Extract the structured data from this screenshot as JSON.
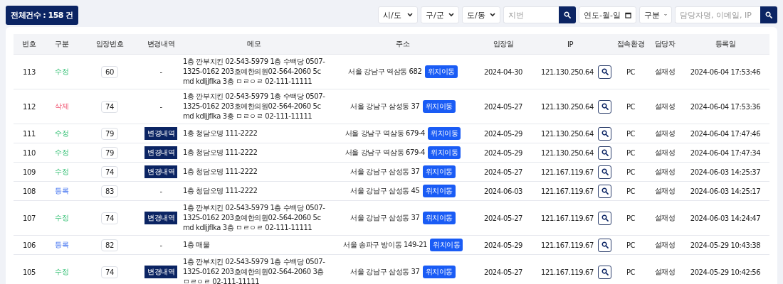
{
  "total_badge": "전체건수 : 158 건",
  "filters": {
    "selects": [
      "시/도",
      "구/군",
      "도/동"
    ],
    "lot_placeholder": "지번",
    "date_placeholder": "연도-월-일",
    "type_select": "구분",
    "keyword_placeholder": "담당자명, 이메일, IP"
  },
  "table": {
    "columns": [
      "번호",
      "구분",
      "임장번호",
      "변경내역",
      "메모",
      "주소",
      "임장일",
      "IP",
      "접속환경",
      "담당자",
      "등록일"
    ],
    "rows": [
      {
        "no": "113",
        "category": {
          "text": "수정",
          "kind": "edit"
        },
        "visit_no": "60",
        "history": {
          "kind": "none",
          "text": "-"
        },
        "memo": "1층 깐부치킨 02-543-5979 1층 수백당 0507-1325-0162 203호예한의원02-564-2060 5cmd kdljjflka 3층 ㅁㄹㅇㄹ 02-111-11111",
        "address": "서울 강남구 역삼동 682",
        "move_label": "위치이동",
        "visit_date": "2024-04-30",
        "ip": "121.130.250.64",
        "env": "PC",
        "manager": "설재성",
        "registered": "2024-06-04 17:53:46"
      },
      {
        "no": "112",
        "category": {
          "text": "삭제",
          "kind": "delete"
        },
        "visit_no": "74",
        "history": {
          "kind": "none",
          "text": "-"
        },
        "memo": "1층 깐부치킨 02-543-5979 1층 수백당 0507-1325-0162 203호예한의원02-564-2060 5cmd kdljjflka 3층 ㅁㄹㅇㄹ 02-111-11111",
        "address": "서울 강남구 삼성동 37",
        "move_label": "위치이동",
        "visit_date": "2024-05-27",
        "ip": "121.130.250.64",
        "env": "PC",
        "manager": "설재성",
        "registered": "2024-06-04 17:53:36"
      },
      {
        "no": "111",
        "category": {
          "text": "수정",
          "kind": "edit"
        },
        "visit_no": "79",
        "history": {
          "kind": "button",
          "text": "변경내역"
        },
        "memo": "1층 청담오뎅 111-2222",
        "address": "서울 강남구 역삼동 679-4",
        "move_label": "위치이동",
        "visit_date": "2024-05-29",
        "ip": "121.130.250.64",
        "env": "PC",
        "manager": "설재성",
        "registered": "2024-06-04 17:47:46"
      },
      {
        "no": "110",
        "category": {
          "text": "수정",
          "kind": "edit"
        },
        "visit_no": "79",
        "history": {
          "kind": "button",
          "text": "변경내역"
        },
        "memo": "1층 청담오뎅 111-2222",
        "address": "서울 강남구 역삼동 679-4",
        "move_label": "위치이동",
        "visit_date": "2024-05-29",
        "ip": "121.130.250.64",
        "env": "PC",
        "manager": "설재성",
        "registered": "2024-06-04 17:47:34"
      },
      {
        "no": "109",
        "category": {
          "text": "수정",
          "kind": "edit"
        },
        "visit_no": "74",
        "history": {
          "kind": "button",
          "text": "변경내역"
        },
        "memo": "1층 청담오뎅 111-2222",
        "address": "서울 강남구 삼성동 37",
        "move_label": "위치이동",
        "visit_date": "2024-05-27",
        "ip": "121.167.119.67",
        "env": "PC",
        "manager": "설재성",
        "registered": "2024-06-03 14:25:37"
      },
      {
        "no": "108",
        "category": {
          "text": "등록",
          "kind": "register"
        },
        "visit_no": "83",
        "history": {
          "kind": "none",
          "text": "-"
        },
        "memo": "1층 청담오뎅 111-2222",
        "address": "서울 강남구 삼성동 45",
        "move_label": "위치이동",
        "visit_date": "2024-06-03",
        "ip": "121.167.119.67",
        "env": "PC",
        "manager": "설재성",
        "registered": "2024-06-03 14:25:17"
      },
      {
        "no": "107",
        "category": {
          "text": "수정",
          "kind": "edit"
        },
        "visit_no": "74",
        "history": {
          "kind": "button",
          "text": "변경내역"
        },
        "memo": "1층 깐부치킨 02-543-5979 1층 수백당 0507-1325-0162 203호예한의원02-564-2060 5cmd kdljjflka 3층 ㅁㄹㅇㄹ 02-111-11111",
        "address": "서울 강남구 삼성동 37",
        "move_label": "위치이동",
        "visit_date": "2024-05-27",
        "ip": "121.167.119.67",
        "env": "PC",
        "manager": "설재성",
        "registered": "2024-06-03 14:24:47"
      },
      {
        "no": "106",
        "category": {
          "text": "등록",
          "kind": "register"
        },
        "visit_no": "82",
        "history": {
          "kind": "none",
          "text": "-"
        },
        "memo": "1층 매물",
        "address": "서울 송파구 방이동 149-21",
        "move_label": "위치이동",
        "visit_date": "2024-05-29",
        "ip": "121.167.119.67",
        "env": "PC",
        "manager": "설재성",
        "registered": "2024-05-29 10:43:38"
      },
      {
        "no": "105",
        "category": {
          "text": "수정",
          "kind": "edit"
        },
        "visit_no": "74",
        "history": {
          "kind": "button",
          "text": "변경내역"
        },
        "memo": "1층 깐부치킨 02-543-5979 1층 수백당 0507-1325-0162 203호예한의원02-564-2060 3층 ㅁㄹㅇㄹ 02-111-11111",
        "address": "서울 강남구 삼성동 37",
        "move_label": "위치이동",
        "visit_date": "2024-05-27",
        "ip": "121.167.119.67",
        "env": "PC",
        "manager": "설재성",
        "registered": "2024-05-29 10:42:56"
      }
    ]
  }
}
